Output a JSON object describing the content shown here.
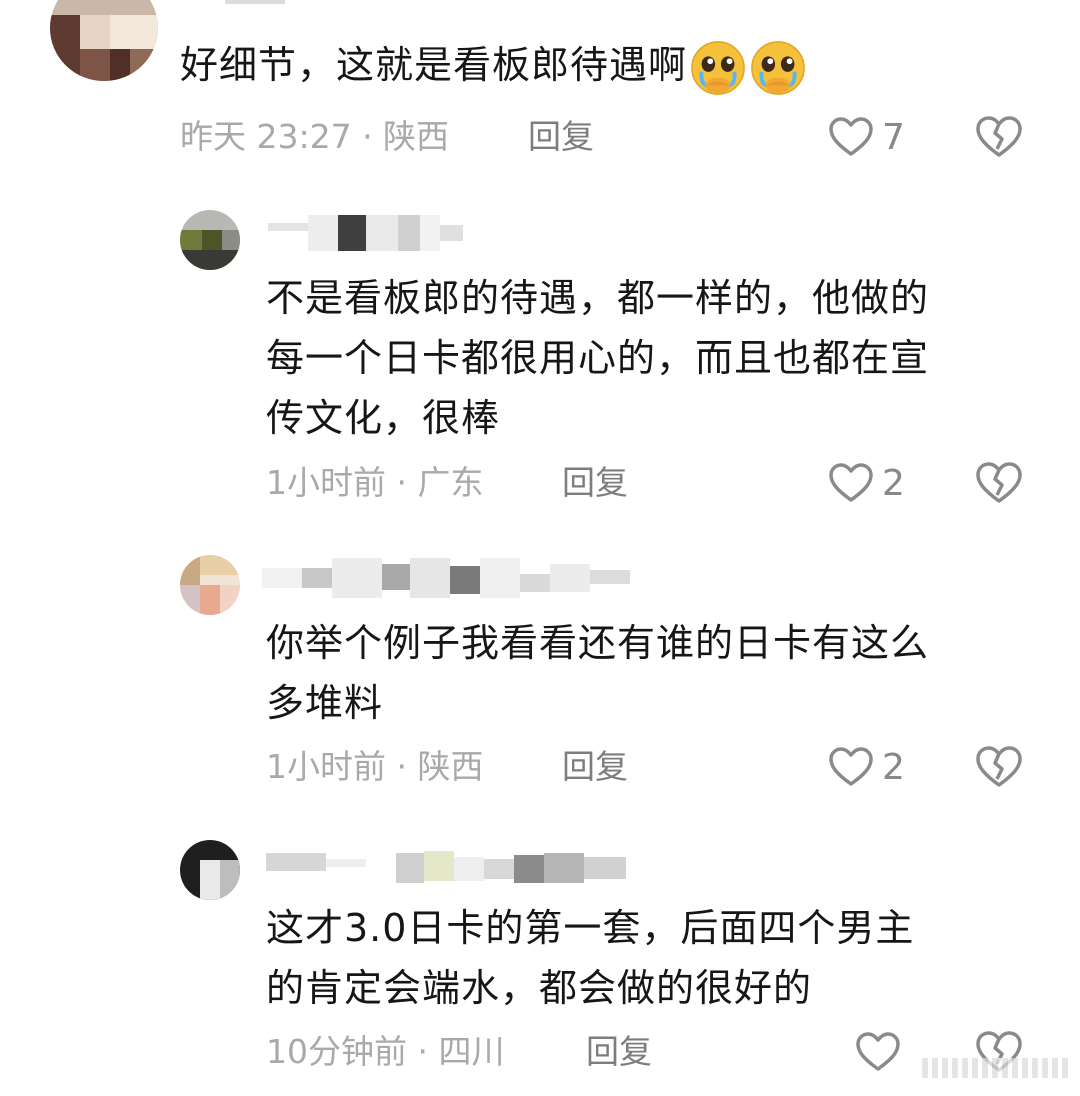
{
  "comments": [
    {
      "text_lines": [
        "好细节，这就是看板郎待遇啊"
      ],
      "emojis": [
        "pleading-face-emoji",
        "pleading-face-emoji"
      ],
      "time": "昨天 23:27 · 陕西",
      "reply": "回复",
      "likes": "7"
    },
    {
      "text_lines": [
        "不是看板郎的待遇，都一样的，他做的",
        "每一个日卡都很用心的，而且也都在宣",
        "传文化，很棒"
      ],
      "time": "1小时前 · 广东",
      "reply": "回复",
      "likes": "2"
    },
    {
      "text_lines": [
        "你举个例子我看看还有谁的日卡有这么",
        "多堆料"
      ],
      "time": "1小时前 · 陕西",
      "reply": "回复",
      "likes": "2"
    },
    {
      "text_lines": [
        "这才3.0日卡的第一套，后面四个男主",
        "的肯定会端水，都会做的很好的"
      ],
      "time": "10分钟前 · 四川",
      "reply": "回复",
      "likes": ""
    }
  ],
  "colors": {
    "text": "#161616",
    "meta": "#a9a9a9",
    "reply": "#7d7d7d",
    "icon": "#8a8a8a"
  },
  "icons": {
    "like": "heart-outline-icon",
    "dislike": "broken-heart-icon"
  }
}
